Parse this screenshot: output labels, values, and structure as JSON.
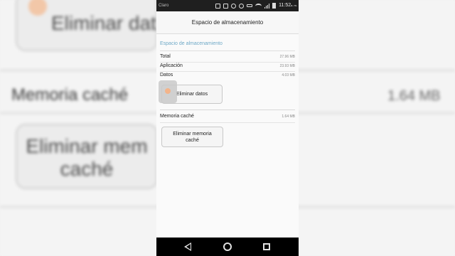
{
  "background": {
    "clear_data_button": "Eliminar dat",
    "cache_label": "Memoria caché",
    "cache_value": "1.64 MB",
    "clear_cache_button_line1": "Eliminar mem",
    "clear_cache_button_line2": "caché"
  },
  "statusbar": {
    "carrier": "Claro",
    "time": "11:52",
    "am_pm": "a. m."
  },
  "header": {
    "title": "Espacio de almacenamiento"
  },
  "storage": {
    "section_title": "Espacio de almacenamiento",
    "rows": [
      {
        "label": "Total",
        "value": "27.96 MB"
      },
      {
        "label": "Aplicación",
        "value": "23.93 MB"
      },
      {
        "label": "Datos",
        "value": "4.03 MB"
      }
    ],
    "clear_data_button": "Eliminar datos"
  },
  "cache": {
    "label": "Memoria caché",
    "value": "1.64 MB",
    "clear_cache_button_line1": "Eliminar memoria",
    "clear_cache_button_line2": "caché"
  },
  "navbar": {
    "back_icon": "back-triangle-icon",
    "home_icon": "home-circle-icon",
    "recent_icon": "recent-apps-square-icon"
  },
  "colors": {
    "accent": "#6fa9c7",
    "touch_indicator": "#f3b48a"
  }
}
